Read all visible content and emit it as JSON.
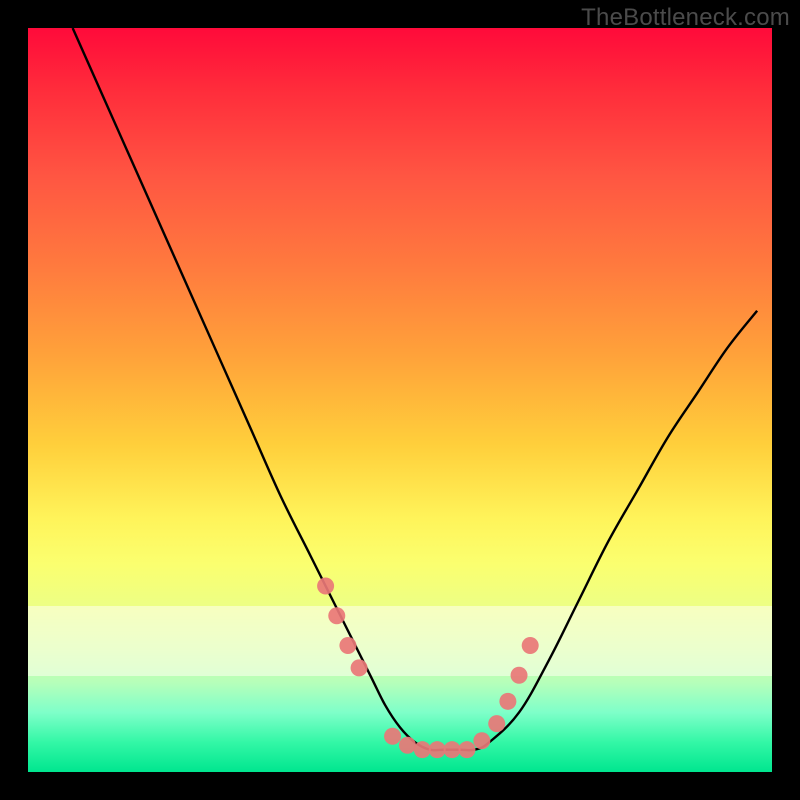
{
  "watermark": {
    "text": "TheBottleneck.com"
  },
  "colors": {
    "frame": "#000000",
    "curve": "#000000",
    "markers": "#e97777",
    "gradient_stops": [
      "#ff0a3a",
      "#ffcf3b",
      "#00e68f"
    ]
  },
  "chart_data": {
    "type": "line",
    "title": "",
    "xlabel": "",
    "ylabel": "",
    "xlim": [
      0,
      100
    ],
    "ylim": [
      0,
      100
    ],
    "grid": false,
    "legend": null,
    "series": [
      {
        "name": "bottleneck-curve",
        "x": [
          6,
          10,
          14,
          18,
          22,
          26,
          30,
          34,
          38,
          42,
          46,
          48,
          50,
          52,
          54,
          56,
          58,
          60,
          62,
          66,
          70,
          74,
          78,
          82,
          86,
          90,
          94,
          98
        ],
        "y": [
          100,
          91,
          82,
          73,
          64,
          55,
          46,
          37,
          29,
          21,
          13,
          9,
          6,
          4,
          3,
          3,
          3,
          3,
          4,
          8,
          15,
          23,
          31,
          38,
          45,
          51,
          57,
          62
        ]
      }
    ],
    "markers": {
      "name": "highlight-points",
      "x": [
        40,
        41.5,
        43,
        44.5,
        49,
        51,
        53,
        55,
        57,
        59,
        61,
        63,
        64.5,
        66,
        67.5
      ],
      "y": [
        25,
        21,
        17,
        14,
        4.8,
        3.6,
        3.0,
        3.0,
        3.0,
        3.0,
        4.2,
        6.5,
        9.5,
        13,
        17
      ]
    }
  }
}
